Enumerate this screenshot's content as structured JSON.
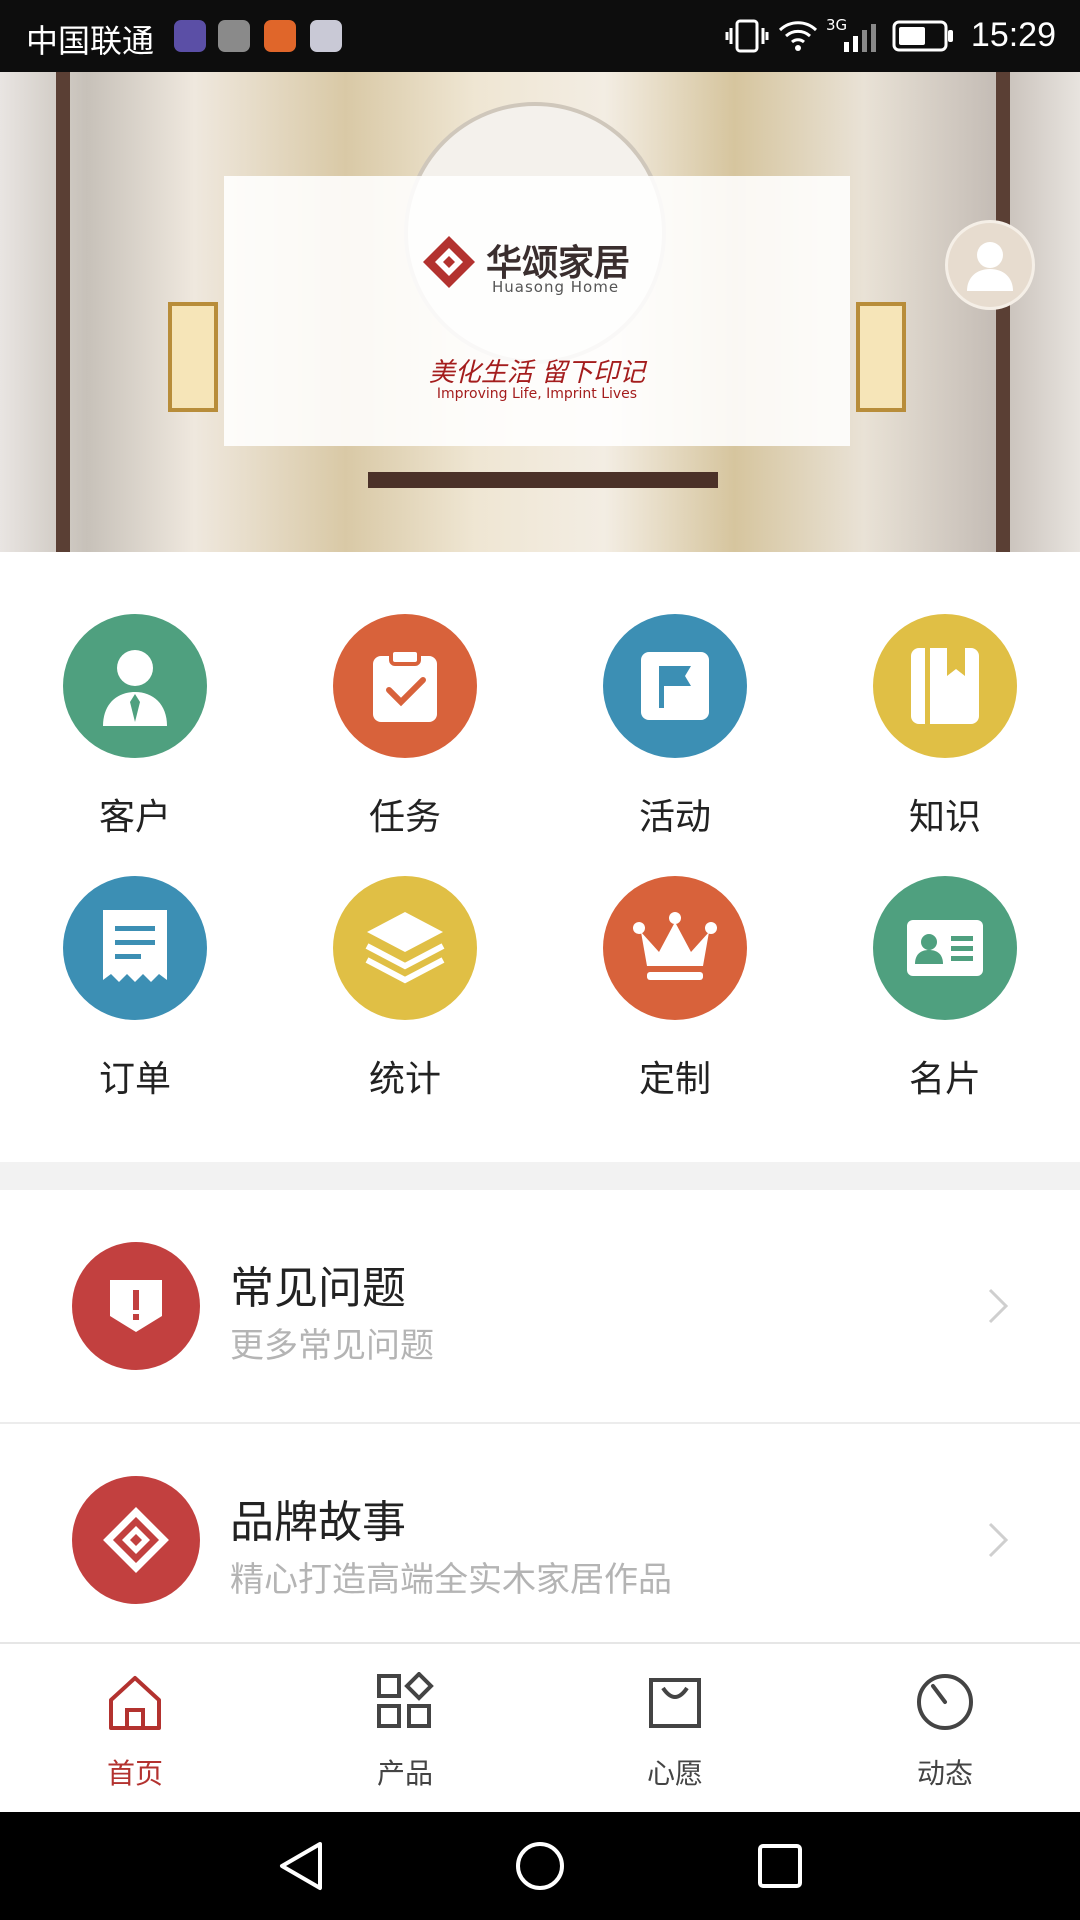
{
  "status_bar": {
    "carrier": "中国联通",
    "time": "15:29",
    "network": "3G"
  },
  "banner": {
    "brand_cn": "华颂家居",
    "brand_en": "Huasong Home",
    "slogan_cn": "美化生活 留下印记",
    "slogan_en": "Improving Life, Imprint Lives"
  },
  "grid": [
    {
      "label": "客户",
      "color": "#4fa07f",
      "icon": "customer-icon"
    },
    {
      "label": "任务",
      "color": "#d8623b",
      "icon": "task-icon"
    },
    {
      "label": "活动",
      "color": "#3c8fb4",
      "icon": "flag-icon"
    },
    {
      "label": "知识",
      "color": "#e0bf45",
      "icon": "book-icon"
    },
    {
      "label": "订单",
      "color": "#3c8fb4",
      "icon": "receipt-icon"
    },
    {
      "label": "统计",
      "color": "#e0bf45",
      "icon": "layers-icon"
    },
    {
      "label": "定制",
      "color": "#d8623b",
      "icon": "crown-icon"
    },
    {
      "label": "名片",
      "color": "#4fa07f",
      "icon": "id-card-icon"
    }
  ],
  "list": [
    {
      "title": "常见问题",
      "subtitle": "更多常见问题",
      "icon": "alert-shield-icon"
    },
    {
      "title": "品牌故事",
      "subtitle": "精心打造高端全实木家居作品",
      "icon": "brand-logo-icon"
    }
  ],
  "tabs": [
    {
      "label": "首页",
      "icon": "home-icon",
      "active": true
    },
    {
      "label": "产品",
      "icon": "products-icon",
      "active": false
    },
    {
      "label": "心愿",
      "icon": "wishlist-bag-icon",
      "active": false
    },
    {
      "label": "动态",
      "icon": "activity-clock-icon",
      "active": false
    }
  ],
  "colors": {
    "accent": "#b3322f",
    "list_icon_bg": "#c2403f"
  }
}
